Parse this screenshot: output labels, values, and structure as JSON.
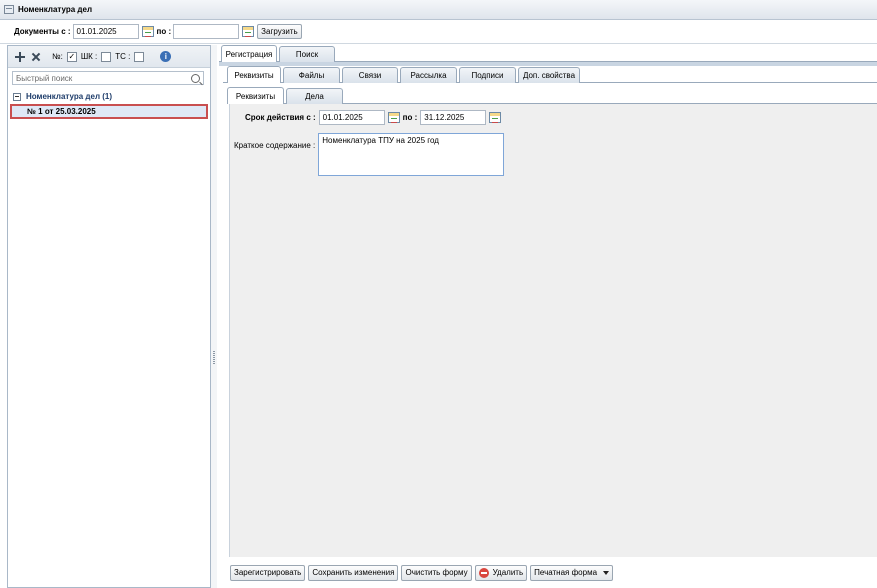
{
  "window": {
    "title": "Номенклатура дел"
  },
  "filter": {
    "docs_from_label": "Документы с :",
    "docs_from_value": "01.01.2025",
    "to_label": "по :",
    "to_value": "",
    "load_button": "Загрузить"
  },
  "left": {
    "toolbar": {
      "num_label": "№:",
      "num_checked": "✓",
      "shk_label": "ШК :",
      "tc_label": "ТС :"
    },
    "search_placeholder": "Быстрый поиск",
    "tree": {
      "root_label": "Номенклатура дел (1)",
      "items": [
        {
          "label": "№ 1 от 25.03.2025"
        }
      ]
    }
  },
  "tabs": {
    "level1": [
      {
        "label": "Регистрация"
      },
      {
        "label": "Поиск"
      }
    ],
    "level2": [
      {
        "label": "Реквизиты"
      },
      {
        "label": "Файлы"
      },
      {
        "label": "Связи"
      },
      {
        "label": "Рассылка"
      },
      {
        "label": "Подписи"
      },
      {
        "label": "Доп. свойства"
      }
    ],
    "level3": [
      {
        "label": "Реквизиты"
      },
      {
        "label": "Дела"
      }
    ]
  },
  "form": {
    "validity_label": "Срок действия с :",
    "validity_from": "01.01.2025",
    "validity_to_label": "по :",
    "validity_to": "31.12.2025",
    "summary_label": "Краткое содержание :",
    "summary_value": "Номенклатура ТПУ на 2025 год"
  },
  "footer": {
    "register": "Зарегистрировать",
    "save": "Сохранить изменения",
    "clear": "Очистить форму",
    "delete": "Удалить",
    "print": "Печатная форма"
  }
}
